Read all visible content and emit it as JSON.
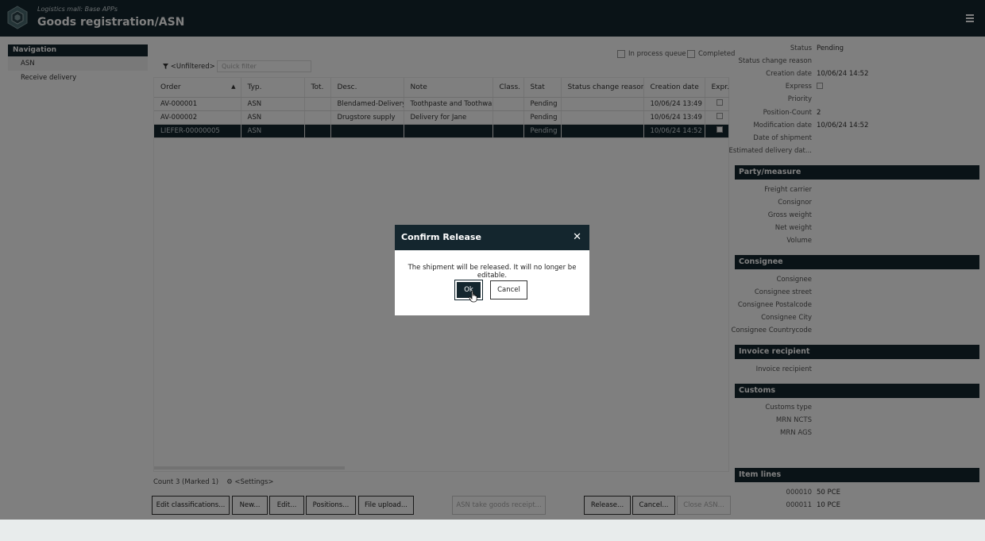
{
  "header": {
    "subtitle": "Logistics mall: Base APPs",
    "title": "Goods registration/ASN",
    "menu_icon": "hamburger-menu-icon",
    "logo_icon": "hexagon-logo-icon"
  },
  "nav": {
    "heading": "Navigation",
    "items": [
      {
        "label": "ASN",
        "active": true
      },
      {
        "label": "Receive delivery",
        "active": false
      }
    ]
  },
  "filter": {
    "label": "<Unfiltered>",
    "icon": "filter-icon",
    "quick_filter_placeholder": "Quick filter",
    "in_process_queue": "In process queue",
    "completed": "Completed"
  },
  "table": {
    "columns": [
      "Order",
      "Typ.",
      "Tot.",
      "Desc.",
      "Note",
      "Class.",
      "Stat",
      "Status change reason",
      "Creation date",
      "Expr."
    ],
    "rows": [
      {
        "order": "AV-000001",
        "typ": "ASN",
        "tot": "",
        "desc": "Blendamed-Delivery",
        "note": "Toothpaste and Toothwash",
        "class": "",
        "stat": "Pending",
        "reason": "",
        "created": "10/06/24 13:49",
        "selected": false
      },
      {
        "order": "AV-000002",
        "typ": "ASN",
        "tot": "",
        "desc": "Drugstore supply",
        "note": "Delivery for Jane",
        "class": "",
        "stat": "Pending",
        "reason": "",
        "created": "10/06/24 13:49",
        "selected": false
      },
      {
        "order": "LIEFER-00000005",
        "typ": "ASN",
        "tot": "",
        "desc": "",
        "note": "",
        "class": "",
        "stat": "Pending",
        "reason": "",
        "created": "10/06/24 14:52",
        "selected": true
      }
    ]
  },
  "footer": {
    "count": "Count 3 (Marked 1)",
    "settings": "<Settings>",
    "settings_icon": "gear-icon"
  },
  "buttons": {
    "edit_classifications": "Edit classifications...",
    "new": "New...",
    "edit": "Edit...",
    "positions": "Positions...",
    "file_upload": "File upload...",
    "asn_take_goods": "ASN take goods receipt...",
    "release": "Release...",
    "cancel": "Cancel...",
    "close_asn": "Close ASN..."
  },
  "details": {
    "status_label": "Status",
    "status_value": "Pending",
    "status_change_reason_label": "Status change reason",
    "creation_date_label": "Creation date",
    "creation_date_value": "10/06/24 14:52",
    "express_label": "Express",
    "priority_label": "Priority",
    "position_count_label": "Position-Count",
    "position_count_value": "2",
    "modification_date_label": "Modification date",
    "modification_date_value": "10/06/24 14:52",
    "date_of_shipment_label": "Date of shipment",
    "estimated_delivery_label": "Estimated delivery dat..."
  },
  "party": {
    "heading": "Party/measure",
    "freight_carrier": "Freight carrier",
    "consignor": "Consignor",
    "gross_weight": "Gross weight",
    "net_weight": "Net weight",
    "volume": "Volume"
  },
  "consignee": {
    "heading": "Consignee",
    "consignee": "Consignee",
    "street": "Consignee street",
    "postalcode": "Consignee Postalcode",
    "city": "Consignee City",
    "countrycode": "Consignee Countrycode"
  },
  "invoice": {
    "heading": "Invoice recipient",
    "recipient": "Invoice recipient"
  },
  "customs": {
    "heading": "Customs",
    "type": "Customs type",
    "mrn_ncts": "MRN NCTS",
    "mrn_ags": "MRN AGS"
  },
  "item_lines": {
    "heading": "Item lines",
    "lines": [
      {
        "no": "000010",
        "qty": "50 PCE"
      },
      {
        "no": "000011",
        "qty": "10 PCE"
      }
    ]
  },
  "dialog": {
    "title": "Confirm Release",
    "message": "The shipment will be released. It will no longer be editable.",
    "ok": "Ok",
    "cancel": "Cancel",
    "close_icon": "close-icon"
  },
  "colors": {
    "header_bg": "#14262e",
    "accent": "#14262e",
    "page_bg": "#ffffff"
  }
}
